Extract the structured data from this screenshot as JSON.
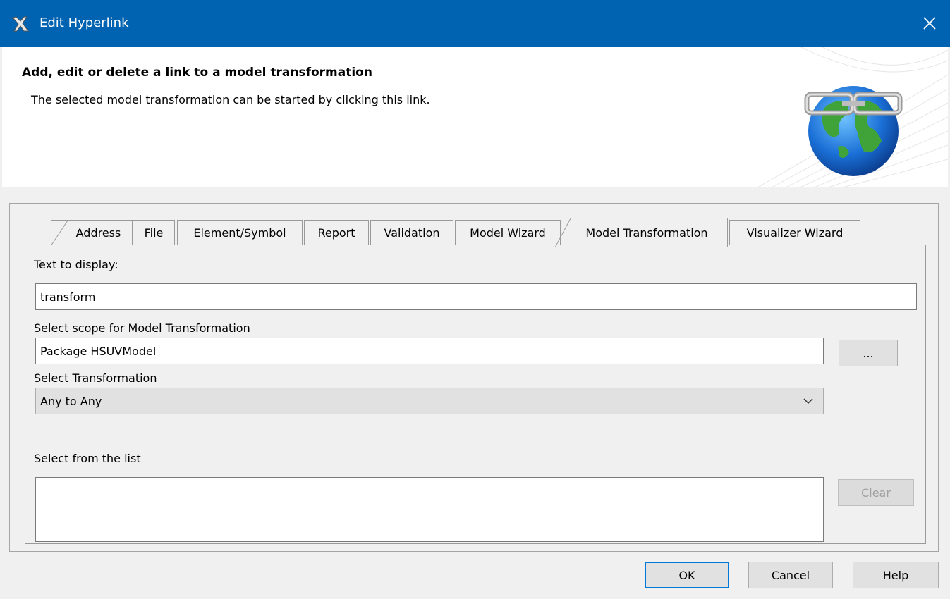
{
  "window": {
    "title": "Edit Hyperlink",
    "close_icon": "close-icon",
    "app_icon": "magicdraw-icon"
  },
  "banner": {
    "heading": "Add, edit or delete a link to a model transformation",
    "subheading": "The selected model transformation can be started by clicking this link.",
    "image_icon": "globe-link-icon"
  },
  "tabs": [
    {
      "label": "Address"
    },
    {
      "label": "File"
    },
    {
      "label": "Element/Symbol"
    },
    {
      "label": "Report"
    },
    {
      "label": "Validation"
    },
    {
      "label": "Model Wizard"
    },
    {
      "label": "Model Transformation",
      "active": true
    },
    {
      "label": "Visualizer Wizard"
    }
  ],
  "form": {
    "text_to_display_label": "Text to display:",
    "text_to_display_value": "transform",
    "scope_label": "Select scope for Model Transformation",
    "scope_value": "Package HSUVModel",
    "browse_label": "...",
    "transformation_label": "Select Transformation",
    "transformation_value": "Any to Any",
    "list_label": "Select from the list",
    "clear_label": "Clear"
  },
  "buttons": {
    "ok": "OK",
    "cancel": "Cancel",
    "help": "Help"
  },
  "colors": {
    "titlebar": "#0063b1",
    "default_button_border": "#0078d7"
  }
}
